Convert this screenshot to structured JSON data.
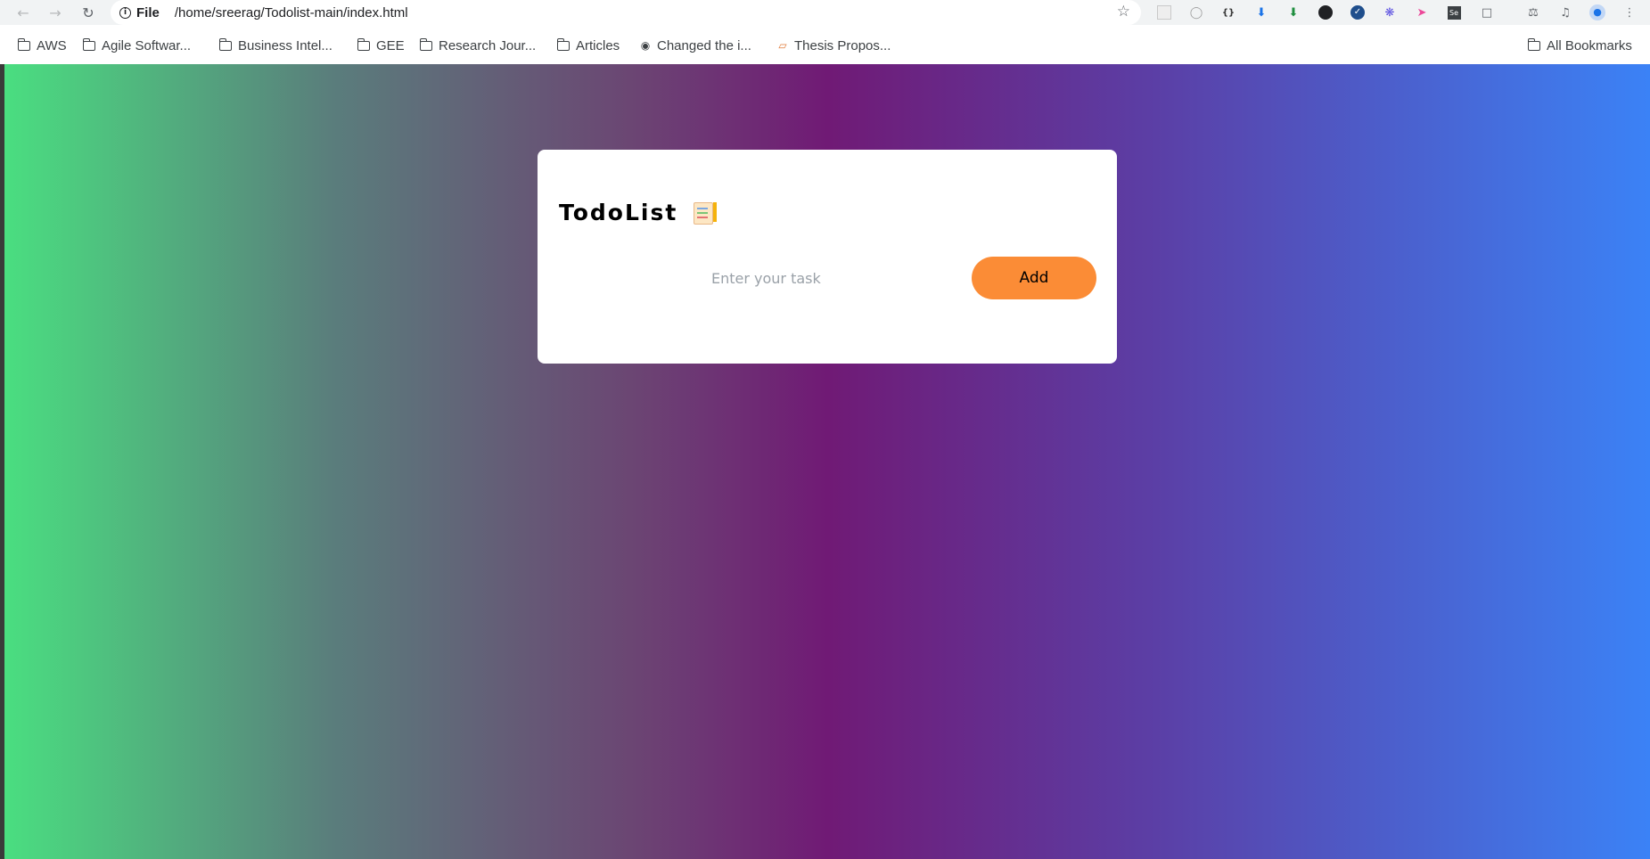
{
  "browser": {
    "omnibox": {
      "scheme_label": "File",
      "url": "/home/sreerag/Todolist-main/index.html"
    },
    "bookmarks": [
      {
        "label": "AWS",
        "icon": "folder-icon"
      },
      {
        "label": "Agile Softwar...",
        "icon": "folder-icon"
      },
      {
        "label": "Business Intel...",
        "icon": "folder-icon"
      },
      {
        "label": "GEE",
        "icon": "folder-icon"
      },
      {
        "label": "Research Jour...",
        "icon": "folder-icon"
      },
      {
        "label": "Articles",
        "icon": "folder-icon"
      },
      {
        "label": "Changed the i...",
        "icon": "github-icon"
      },
      {
        "label": "Thesis Propos...",
        "icon": "favicon-icon"
      },
      {
        "label": "All Bookmarks",
        "icon": "folder-icon"
      }
    ]
  },
  "app": {
    "title": "TodoList",
    "title_icon": "checklist-emoji-icon",
    "input_placeholder": "Enter your task",
    "input_value": "",
    "add_button_label": "Add",
    "colors": {
      "gradient_start": "#4ade80",
      "gradient_mid": "#701a75",
      "gradient_end": "#3b82f6",
      "button": "#fb8c36",
      "card": "#ffffff"
    }
  }
}
